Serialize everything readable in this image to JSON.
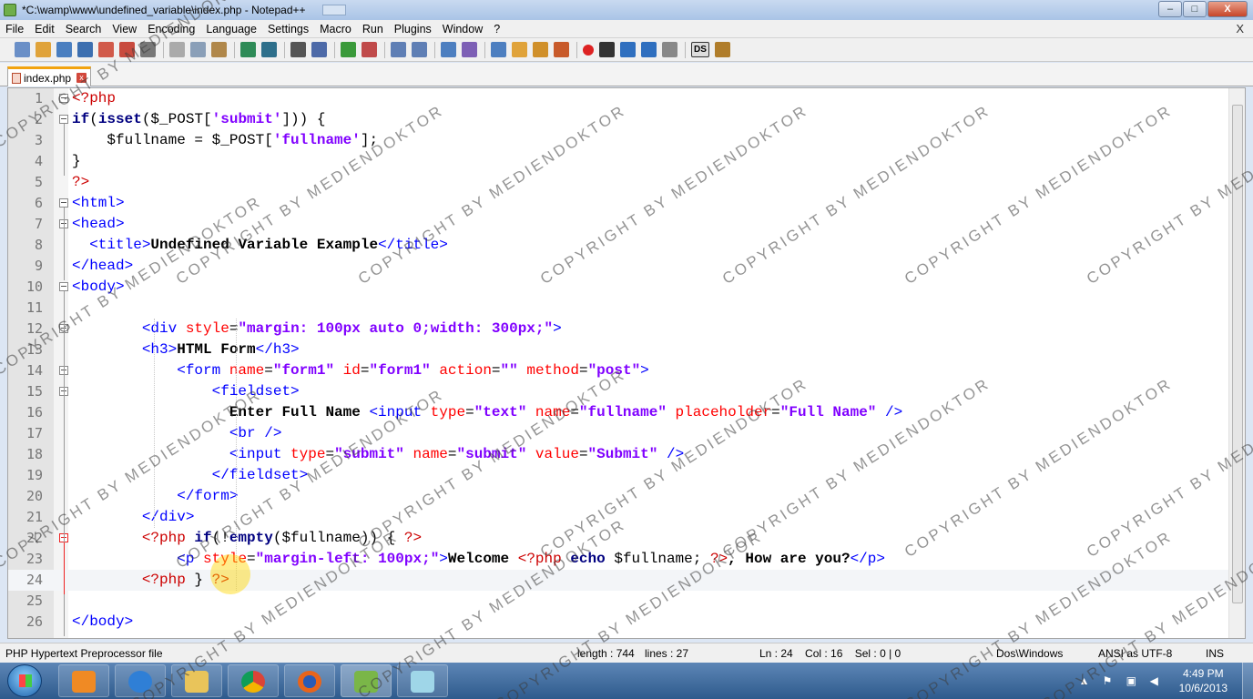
{
  "window": {
    "title": "*C:\\wamp\\www\\undefined_variable\\index.php - Notepad++",
    "minimize": "–",
    "maximize": "□",
    "close": "X"
  },
  "menu": {
    "items": [
      "File",
      "Edit",
      "Search",
      "View",
      "Encoding",
      "Language",
      "Settings",
      "Macro",
      "Run",
      "Plugins",
      "Window",
      "?"
    ],
    "close_label": "X"
  },
  "toolbar": {
    "buttons": [
      "new-file-icon",
      "open-file-icon",
      "save-icon",
      "save-all-icon",
      "close-icon",
      "close-all-icon",
      "print-icon",
      "cut-icon",
      "copy-icon",
      "paste-icon",
      "undo-icon",
      "redo-icon",
      "find-icon",
      "replace-icon",
      "zoom-in-icon",
      "zoom-out-icon",
      "sync-vertical-icon",
      "sync-horizontal-icon",
      "word-wrap-icon",
      "show-all-chars-icon",
      "indent-guide-icon",
      "user-language-icon",
      "function-list-icon",
      "doc-map-icon",
      "record-macro-icon",
      "stop-macro-icon",
      "play-macro-icon",
      "run-macro-multiple-icon",
      "save-macro-icon",
      "ds-plugin-icon",
      "plugin-icon"
    ],
    "ds_label": "DS"
  },
  "tab": {
    "label": "index.php",
    "close": "x"
  },
  "editor": {
    "current_line": 24,
    "lines": [
      {
        "n": "1",
        "fold": "box"
      },
      {
        "n": "2",
        "fold": "box"
      },
      {
        "n": "3",
        "fold": ""
      },
      {
        "n": "4",
        "fold": "end"
      },
      {
        "n": "5",
        "fold": ""
      },
      {
        "n": "6",
        "fold": "box"
      },
      {
        "n": "7",
        "fold": "box"
      },
      {
        "n": "8",
        "fold": ""
      },
      {
        "n": "9",
        "fold": "end"
      },
      {
        "n": "10",
        "fold": "box"
      },
      {
        "n": "11",
        "fold": ""
      },
      {
        "n": "12",
        "fold": "box"
      },
      {
        "n": "13",
        "fold": ""
      },
      {
        "n": "14",
        "fold": "box"
      },
      {
        "n": "15",
        "fold": "box"
      },
      {
        "n": "16",
        "fold": ""
      },
      {
        "n": "17",
        "fold": ""
      },
      {
        "n": "18",
        "fold": ""
      },
      {
        "n": "19",
        "fold": "end"
      },
      {
        "n": "20",
        "fold": "end"
      },
      {
        "n": "21",
        "fold": "end"
      },
      {
        "n": "22",
        "fold": "red"
      },
      {
        "n": "23",
        "fold": ""
      },
      {
        "n": "24",
        "fold": "endred"
      },
      {
        "n": "25",
        "fold": ""
      },
      {
        "n": "26",
        "fold": "end"
      }
    ],
    "code": [
      [
        [
          "php",
          "<?php"
        ]
      ],
      [
        [
          "kw",
          "if"
        ],
        [
          "",
          "("
        ],
        [
          "kw",
          "isset"
        ],
        [
          "",
          "($_POST["
        ],
        [
          "str",
          "'submit'"
        ],
        [
          "",
          "])) {"
        ]
      ],
      [
        [
          "",
          "    $fullname = $_POST["
        ],
        [
          "str",
          "'fullname'"
        ],
        [
          "",
          "];"
        ]
      ],
      [
        [
          "",
          "}"
        ]
      ],
      [
        [
          "php",
          "?>"
        ]
      ],
      [
        [
          "tag",
          "<html>"
        ]
      ],
      [
        [
          "tag",
          "<head>"
        ]
      ],
      [
        [
          "",
          "  "
        ],
        [
          "tag",
          "<title>"
        ],
        [
          "bold",
          "Undefined Variable Example"
        ],
        [
          "tag",
          "</title>"
        ]
      ],
      [
        [
          "tag",
          "</head>"
        ]
      ],
      [
        [
          "tag",
          "<body>"
        ]
      ],
      [
        [
          "",
          ""
        ]
      ],
      [
        [
          "",
          "        "
        ],
        [
          "tag",
          "<div "
        ],
        [
          "attr",
          "style"
        ],
        [
          "",
          "="
        ],
        [
          "str",
          "\"margin: 100px auto 0;width: 300px;\""
        ],
        [
          "tag",
          ">"
        ]
      ],
      [
        [
          "",
          "        "
        ],
        [
          "tag",
          "<h3>"
        ],
        [
          "bold",
          "HTML Form"
        ],
        [
          "tag",
          "</h3>"
        ]
      ],
      [
        [
          "",
          "            "
        ],
        [
          "tag",
          "<form "
        ],
        [
          "attr",
          "name"
        ],
        [
          "",
          "="
        ],
        [
          "str",
          "\"form1\""
        ],
        [
          "",
          " "
        ],
        [
          "attr",
          "id"
        ],
        [
          "",
          "="
        ],
        [
          "str",
          "\"form1\""
        ],
        [
          "",
          " "
        ],
        [
          "attr",
          "action"
        ],
        [
          "",
          "="
        ],
        [
          "str",
          "\"\""
        ],
        [
          "",
          " "
        ],
        [
          "attr",
          "method"
        ],
        [
          "",
          "="
        ],
        [
          "str",
          "\"post\""
        ],
        [
          "tag",
          ">"
        ]
      ],
      [
        [
          "",
          "                "
        ],
        [
          "tag",
          "<fieldset>"
        ]
      ],
      [
        [
          "",
          "                  "
        ],
        [
          "bold",
          "Enter Full Name "
        ],
        [
          "tag",
          "<input "
        ],
        [
          "attr",
          "type"
        ],
        [
          "",
          "="
        ],
        [
          "str",
          "\"text\""
        ],
        [
          "",
          " "
        ],
        [
          "attr",
          "name"
        ],
        [
          "",
          "="
        ],
        [
          "str",
          "\"fullname\""
        ],
        [
          "",
          " "
        ],
        [
          "attr",
          "placeholder"
        ],
        [
          "",
          "="
        ],
        [
          "str",
          "\"Full Name\""
        ],
        [
          "tag",
          " />"
        ]
      ],
      [
        [
          "",
          "                  "
        ],
        [
          "tag",
          "<br />"
        ]
      ],
      [
        [
          "",
          "                  "
        ],
        [
          "tag",
          "<input "
        ],
        [
          "attr",
          "type"
        ],
        [
          "",
          "="
        ],
        [
          "str",
          "\"submit\""
        ],
        [
          "",
          " "
        ],
        [
          "attr",
          "name"
        ],
        [
          "",
          "="
        ],
        [
          "str",
          "\"submit\""
        ],
        [
          "",
          " "
        ],
        [
          "attr",
          "value"
        ],
        [
          "",
          "="
        ],
        [
          "str",
          "\"Submit\""
        ],
        [
          "tag",
          " />"
        ]
      ],
      [
        [
          "",
          "                "
        ],
        [
          "tag",
          "</fieldset>"
        ]
      ],
      [
        [
          "",
          "            "
        ],
        [
          "tag",
          "</form>"
        ]
      ],
      [
        [
          "",
          "        "
        ],
        [
          "tag",
          "</div>"
        ]
      ],
      [
        [
          "",
          "        "
        ],
        [
          "php",
          "<?php "
        ],
        [
          "kw",
          "if"
        ],
        [
          "",
          "(!"
        ],
        [
          "kw",
          "empty"
        ],
        [
          "",
          "($fullname)) { "
        ],
        [
          "php",
          "?>"
        ]
      ],
      [
        [
          "",
          "            "
        ],
        [
          "tag",
          "<p "
        ],
        [
          "attr",
          "style"
        ],
        [
          "",
          "="
        ],
        [
          "str",
          "\"margin-left: 100px;\""
        ],
        [
          "tag",
          ">"
        ],
        [
          "bold",
          "Welcome "
        ],
        [
          "php",
          "<?php "
        ],
        [
          "kw",
          "echo"
        ],
        [
          "",
          " $fullname; "
        ],
        [
          "php",
          "?>"
        ],
        [
          "bold",
          ", How are you?"
        ],
        [
          "tag",
          "</p>"
        ]
      ],
      [
        [
          "",
          "        "
        ],
        [
          "php",
          "<?php "
        ],
        [
          "",
          "} "
        ],
        [
          "php",
          "?>"
        ]
      ],
      [
        [
          "",
          ""
        ]
      ],
      [
        [
          "tag",
          "</body>"
        ]
      ]
    ]
  },
  "status": {
    "file_type": "PHP Hypertext Preprocessor file",
    "length": "length : 744",
    "lines": "lines : 27",
    "position": "Ln : 24    Col : 16    Sel : 0 | 0",
    "eol": "Dos\\Windows",
    "encoding": "ANSI as UTF-8",
    "mode": "INS"
  },
  "taskbar": {
    "apps": [
      "media-player-icon",
      "internet-explorer-icon",
      "file-explorer-icon",
      "chrome-icon",
      "firefox-icon",
      "notepad-plus-plus-icon",
      "notepad-icon"
    ],
    "time": "4:49 PM",
    "date": "10/6/2013"
  },
  "watermark": "COPYRIGHT BY MEDIENDOKTOR",
  "colors": {
    "keyword": "#000080",
    "php_tag": "#cc0000",
    "html_tag": "#0000ff",
    "attribute": "#ff0000",
    "string": "#8000ff"
  }
}
